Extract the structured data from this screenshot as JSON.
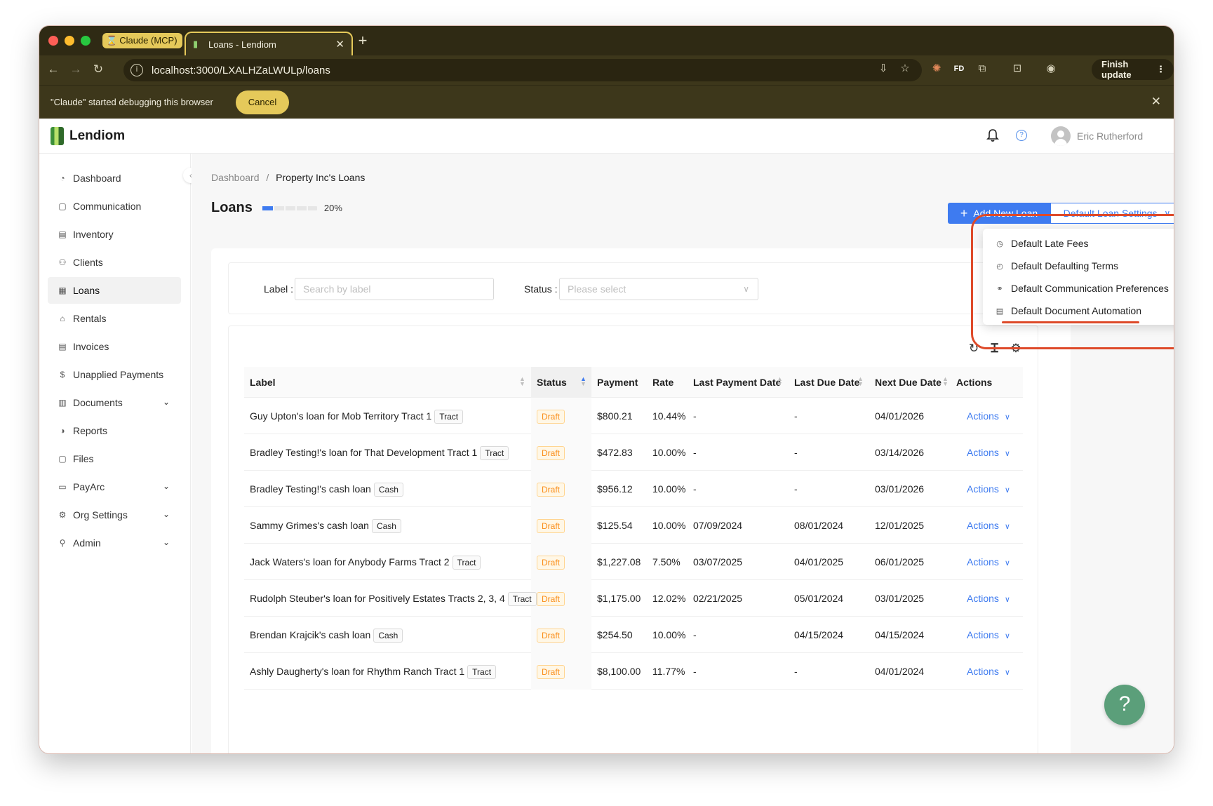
{
  "browser": {
    "tab_group_label": "Claude (MCP)",
    "active_tab_title": "Loans - Lendiom",
    "url": "localhost:3000/LXALHZaLWULp/loans",
    "finish_update_label": "Finish update",
    "extension_label": "FD"
  },
  "debug_bar": {
    "message": "\"Claude\" started debugging this browser",
    "cancel_label": "Cancel"
  },
  "app": {
    "brand": "Lendiom",
    "user_name": "Eric Rutherford"
  },
  "sidebar": {
    "items": [
      {
        "label": "Dashboard",
        "icon": "dashboard-icon"
      },
      {
        "label": "Communication",
        "icon": "chat-icon"
      },
      {
        "label": "Inventory",
        "icon": "inventory-icon"
      },
      {
        "label": "Clients",
        "icon": "clients-icon"
      },
      {
        "label": "Loans",
        "icon": "loans-icon",
        "active": true
      },
      {
        "label": "Rentals",
        "icon": "home-icon"
      },
      {
        "label": "Invoices",
        "icon": "invoice-icon"
      },
      {
        "label": "Unapplied Payments",
        "icon": "dollar-icon"
      },
      {
        "label": "Documents",
        "icon": "documents-icon",
        "expandable": true
      },
      {
        "label": "Reports",
        "icon": "reports-icon"
      },
      {
        "label": "Files",
        "icon": "files-icon"
      },
      {
        "label": "PayArc",
        "icon": "card-icon",
        "expandable": true
      },
      {
        "label": "Org Settings",
        "icon": "gear-icon",
        "expandable": true
      },
      {
        "label": "Admin",
        "icon": "user-icon",
        "expandable": true
      }
    ]
  },
  "breadcrumb": {
    "root": "Dashboard",
    "separator": "/",
    "current": "Property Inc's Loans"
  },
  "page": {
    "title": "Loans",
    "progress_percent": 20,
    "progress_label": "20%",
    "add_button": "Add New Loan",
    "settings_button": "Default Loan Settings"
  },
  "settings_menu": {
    "items": [
      {
        "label": "Default Late Fees",
        "icon": "clock-icon"
      },
      {
        "label": "Default Defaulting Terms",
        "icon": "history-icon"
      },
      {
        "label": "Default Communication Preferences",
        "icon": "link-icon"
      },
      {
        "label": "Default Document Automation",
        "icon": "document-icon"
      }
    ]
  },
  "filters": {
    "label_label": "Label",
    "label_placeholder": "Search by label",
    "status_label": "Status",
    "status_placeholder": "Please select"
  },
  "table": {
    "columns": [
      "Label",
      "Status",
      "Payment",
      "Rate",
      "Last Payment Date",
      "Last Due Date",
      "Next Due Date",
      "Actions"
    ],
    "rows": [
      {
        "label": "Guy Upton's loan for Mob Territory Tract 1",
        "tag": "Tract",
        "status": "Draft",
        "payment": "$800.21",
        "rate": "10.44%",
        "last_payment": "-",
        "last_due": "-",
        "next_due": "04/01/2026",
        "action": "Actions"
      },
      {
        "label": "Bradley Testing!'s loan for That Development Tract 1",
        "tag": "Tract",
        "status": "Draft",
        "payment": "$472.83",
        "rate": "10.00%",
        "last_payment": "-",
        "last_due": "-",
        "next_due": "03/14/2026",
        "action": "Actions"
      },
      {
        "label": "Bradley Testing!'s cash loan",
        "tag": "Cash",
        "status": "Draft",
        "payment": "$956.12",
        "rate": "10.00%",
        "last_payment": "-",
        "last_due": "-",
        "next_due": "03/01/2026",
        "action": "Actions"
      },
      {
        "label": "Sammy Grimes's cash loan",
        "tag": "Cash",
        "status": "Draft",
        "payment": "$125.54",
        "rate": "10.00%",
        "last_payment": "07/09/2024",
        "last_due": "08/01/2024",
        "next_due": "12/01/2025",
        "action": "Actions"
      },
      {
        "label": "Jack Waters's loan for Anybody Farms Tract 2",
        "tag": "Tract",
        "status": "Draft",
        "payment": "$1,227.08",
        "rate": "7.50%",
        "last_payment": "03/07/2025",
        "last_due": "04/01/2025",
        "next_due": "06/01/2025",
        "action": "Actions"
      },
      {
        "label": "Rudolph Steuber's loan for Positively Estates Tracts 2, 3, 4",
        "tag": "Tract",
        "status": "Draft",
        "payment": "$1,175.00",
        "rate": "12.02%",
        "last_payment": "02/21/2025",
        "last_due": "05/01/2024",
        "next_due": "03/01/2025",
        "action": "Actions"
      },
      {
        "label": "Brendan Krajcik's cash loan",
        "tag": "Cash",
        "status": "Draft",
        "payment": "$254.50",
        "rate": "10.00%",
        "last_payment": "-",
        "last_due": "04/15/2024",
        "next_due": "04/15/2024",
        "action": "Actions"
      },
      {
        "label": "Ashly Daugherty's loan for Rhythm Ranch Tract 1",
        "tag": "Tract",
        "status": "Draft",
        "payment": "$8,100.00",
        "rate": "11.77%",
        "last_payment": "-",
        "last_due": "-",
        "next_due": "04/01/2024",
        "action": "Actions"
      }
    ]
  },
  "help_fab": "?",
  "colors": {
    "primary": "#3e7bf0",
    "draft": "#fa8c16",
    "annotation": "#de4a2a",
    "browser_frame": "#3d371b"
  }
}
